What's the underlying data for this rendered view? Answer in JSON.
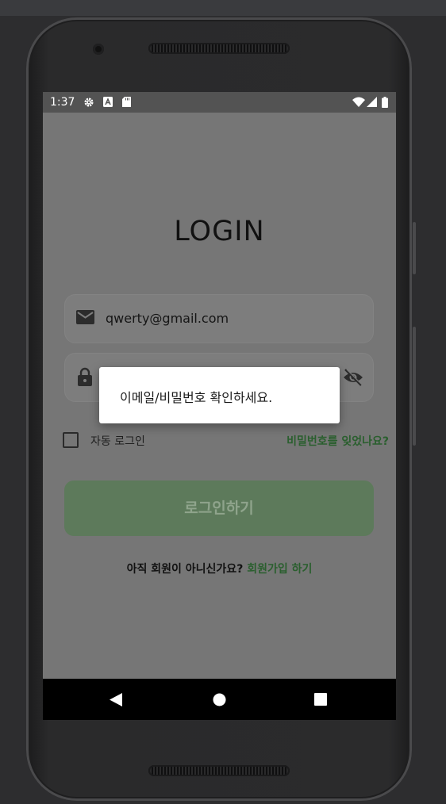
{
  "status_bar": {
    "time": "1:37",
    "icons": [
      "gear-icon",
      "a-box-icon",
      "sd-card-icon",
      "wifi-icon",
      "signal-icon",
      "battery-icon"
    ]
  },
  "login": {
    "title": "LOGIN",
    "email": {
      "value": "qwerty@gmail.com",
      "icon": "mail-icon"
    },
    "password": {
      "value": "",
      "icon": "lock-icon",
      "toggle_icon": "visibility-off-icon"
    },
    "auto_login_label": "자동 로그인",
    "auto_login_checked": false,
    "forgot_password": "비밀번호를 잊었나요?",
    "login_button": "로그인하기",
    "signup_prompt": "아직 회원이 아니신가요?",
    "signup_link": "회원가입 하기"
  },
  "dialog": {
    "message": "이메일/비밀번호 확인하세요."
  },
  "nav": {
    "icons": [
      "back-icon",
      "home-icon",
      "recents-icon"
    ]
  },
  "colors": {
    "accent_green": "#2a5f2e",
    "button_bg": "#5d7a5b",
    "dim_overlay": "#767676"
  }
}
